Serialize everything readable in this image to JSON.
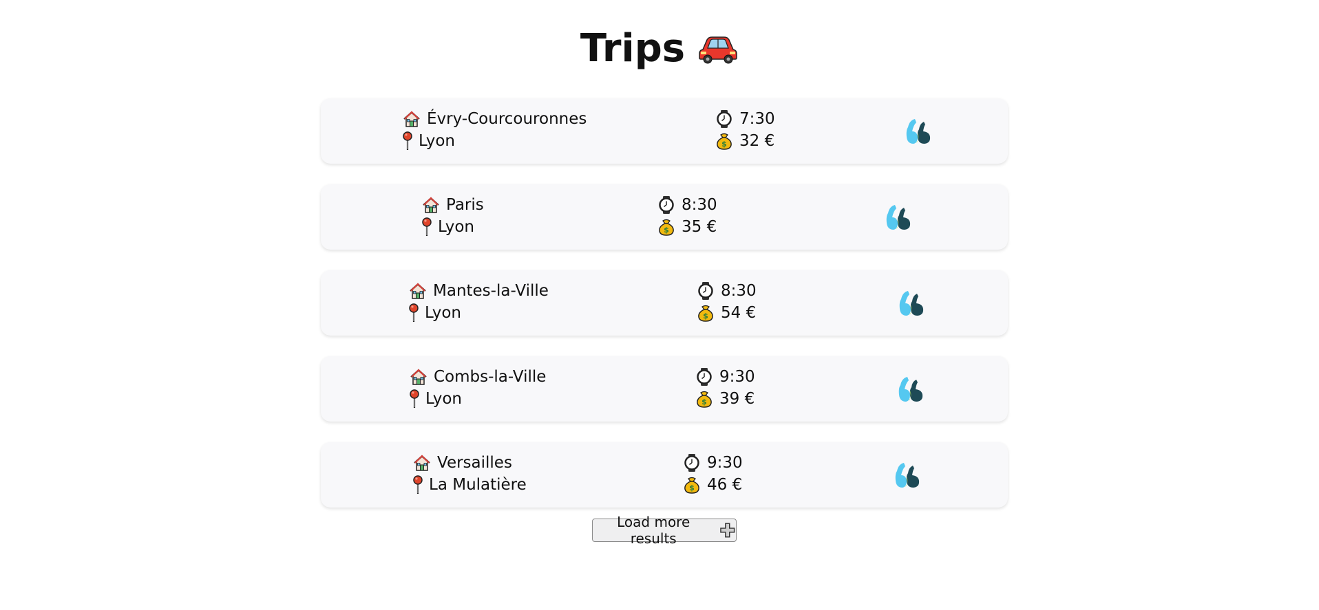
{
  "header": {
    "title": "Trips",
    "title_icon": "car-icon"
  },
  "icons": {
    "departure": "house-icon",
    "destination": "pin-icon",
    "time": "watch-icon",
    "price": "money-bag-icon",
    "provider": "quote-logo-icon"
  },
  "trips": [
    {
      "from": "Évry-Courcouronnes",
      "to": "Lyon",
      "time": "7:30",
      "price": "32 €"
    },
    {
      "from": "Paris",
      "to": "Lyon",
      "time": "8:30",
      "price": "35 €"
    },
    {
      "from": "Mantes-la-Ville",
      "to": "Lyon",
      "time": "8:30",
      "price": "54 €"
    },
    {
      "from": "Combs-la-Ville",
      "to": "Lyon",
      "time": "9:30",
      "price": "39 €"
    },
    {
      "from": "Versailles",
      "to": "La Mulatière",
      "time": "9:30",
      "price": "46 €"
    }
  ],
  "load_more": {
    "label": "Load more results"
  },
  "colors": {
    "card_background": "#f8f8fa",
    "logo_light": "#55c8f0",
    "logo_dark": "#1e4a56",
    "pin_red": "#e0452b",
    "bag_gold": "#f2b90f"
  }
}
